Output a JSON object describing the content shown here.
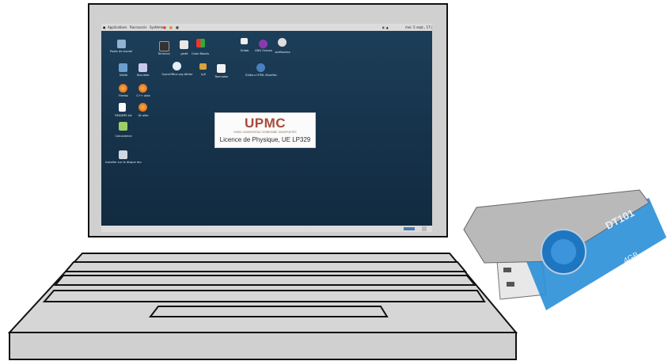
{
  "topbar": {
    "menu_applications": "Applications",
    "menu_raccourcis": "Raccourcis",
    "menu_systeme": "Système",
    "clock": "mer. 5 sept., 17:25"
  },
  "desktop_icons": [
    {
      "label": "Poste de travail"
    },
    {
      "label": "Terminal"
    },
    {
      "label": "gedit"
    },
    {
      "label": "Color Blocks"
    },
    {
      "label": "Scilab"
    },
    {
      "label": "GNU Octave"
    },
    {
      "label": "wxMaxima"
    },
    {
      "label": "SAKAI"
    },
    {
      "label": "Bruneter"
    },
    {
      "label": "OpenOffice.org Writer"
    },
    {
      "label": "LyX"
    },
    {
      "label": "Texmaker"
    },
    {
      "label": "Éditeur HTML Bluefish"
    },
    {
      "label": "Firefox"
    },
    {
      "label": "C++ aide"
    },
    {
      "label": "README.txt"
    },
    {
      "label": "Qt aide"
    },
    {
      "label": "Calculatrice"
    },
    {
      "label": "Installer sur le disque dur"
    }
  ],
  "card": {
    "logo": "UPMC",
    "logo_subtitle": "PARIS UNIVERSITAS SORBONNE UNIVERSITÉS",
    "text": "Licence de Physique, UE LP329"
  },
  "usb_drive": {
    "model": "DT101",
    "capacity": "4GB"
  },
  "colors": {
    "desktop_bg": "#1d3f5a",
    "upmc_red": "#a64a3b",
    "usb_blue": "#2a8fd8"
  }
}
